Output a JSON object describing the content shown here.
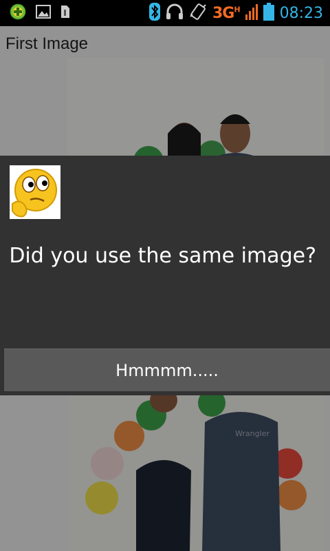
{
  "status_bar": {
    "network": "3G",
    "network_sub": "H",
    "time": "08:23",
    "time_color": "#35b6e6",
    "network_color": "#f26b21",
    "icons": [
      "add-notification-icon",
      "image-notification-icon",
      "file-notification-icon",
      "bluetooth-icon",
      "headset-icon",
      "vibrate-icon",
      "signal-icon",
      "battery-icon"
    ]
  },
  "app": {
    "title": "First Image"
  },
  "dialog": {
    "icon": "thinking-face-icon",
    "message": "Did you use the same image?",
    "button_label": "Hmmmm.....",
    "background": "#323232"
  }
}
